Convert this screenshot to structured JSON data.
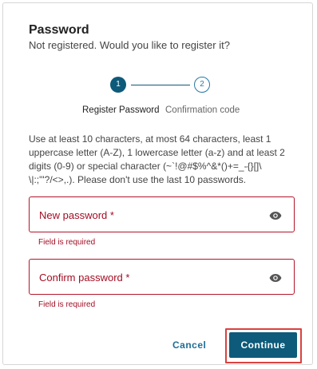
{
  "dialog": {
    "title": "Password",
    "subtitle": "Not registered. Would you like to register it?"
  },
  "stepper": {
    "steps": [
      {
        "number": "1",
        "label": "Register Password",
        "state": "active"
      },
      {
        "number": "2",
        "label": "Confirmation code",
        "state": "pending"
      }
    ]
  },
  "rules_text": "Use at least 10 characters, at most 64 characters, least 1 uppercase letter (A-Z), 1 lowercase letter (a-z) and at least 2 digits (0-9) or special character (~`!@#$%^&*()+=_-{}[]\\ \\|:;\"'?/<>,.). Please don't use the last 10 passwords.",
  "form": {
    "new_password": {
      "label": "New password *",
      "value": "",
      "error": "Field is required",
      "icon": "eye-icon"
    },
    "confirm_password": {
      "label": "Confirm password *",
      "value": "",
      "error": "Field is required",
      "icon": "eye-icon"
    }
  },
  "actions": {
    "cancel_label": "Cancel",
    "continue_label": "Continue"
  },
  "colors": {
    "primary": "#0d5a7a",
    "error": "#a30d23",
    "link": "#1f6d97",
    "highlight": "#d9423f"
  }
}
